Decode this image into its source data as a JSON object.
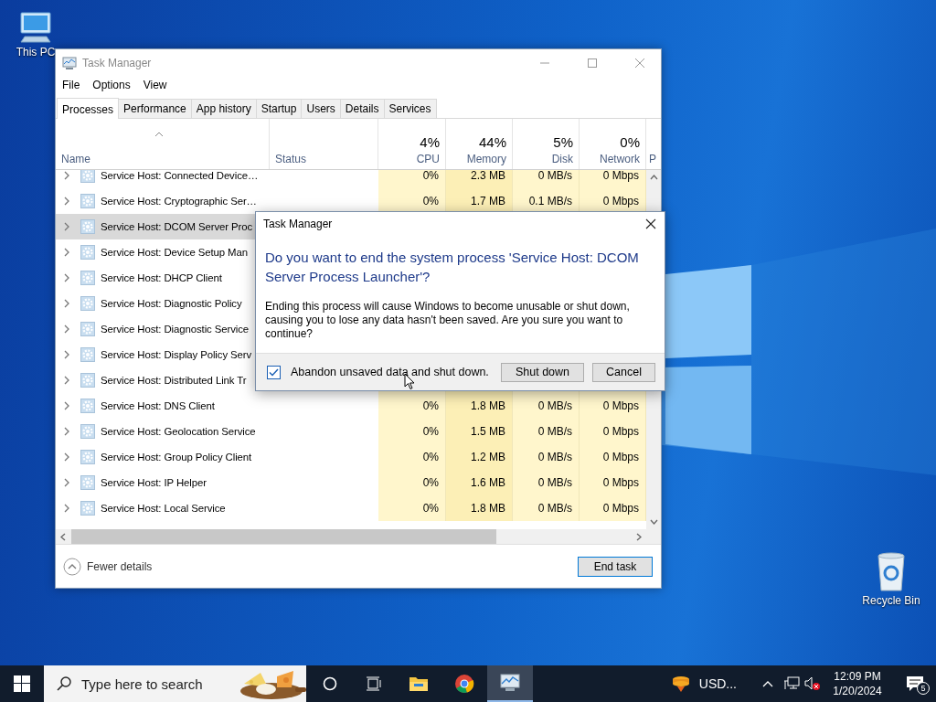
{
  "desktop_icons": [
    {
      "kind": "computer",
      "label": "This PC"
    },
    {
      "kind": "recycle-bin",
      "label": "Recycle Bin"
    }
  ],
  "window": {
    "title": "Task Manager",
    "menu": [
      "File",
      "Options",
      "View"
    ],
    "tabs": [
      {
        "label": "Processes",
        "selected": true
      },
      {
        "label": "Performance",
        "selected": false
      },
      {
        "label": "App history",
        "selected": false
      },
      {
        "label": "Startup",
        "selected": false
      },
      {
        "label": "Users",
        "selected": false
      },
      {
        "label": "Details",
        "selected": false
      },
      {
        "label": "Services",
        "selected": false
      }
    ],
    "columns": [
      {
        "label": "Name",
        "sorted": true
      },
      {
        "label": "Status",
        "sorted": false
      },
      {
        "label": "CPU",
        "total": "4%",
        "sorted": false
      },
      {
        "label": "Memory",
        "total": "44%",
        "sorted": false
      },
      {
        "label": "Disk",
        "total": "5%",
        "sorted": false
      },
      {
        "label": "Network",
        "total": "0%",
        "sorted": false
      },
      {
        "label": "P",
        "sorted": false
      }
    ],
    "rows": [
      {
        "name": "Service Host: Connected Device…",
        "expanded": false,
        "selected": false,
        "cpu": "0%",
        "memory": "2.3 MB",
        "disk": "0 MB/s",
        "network": "0 Mbps"
      },
      {
        "name": "Service Host: Cryptographic Ser…",
        "expanded": false,
        "selected": false,
        "cpu": "0%",
        "memory": "1.7 MB",
        "disk": "0.1 MB/s",
        "network": "0 Mbps"
      },
      {
        "name": "Service Host: DCOM Server Proc",
        "expanded": false,
        "selected": true
      },
      {
        "name": "Service Host: Device Setup Man",
        "expanded": false,
        "selected": false
      },
      {
        "name": "Service Host: DHCP Client",
        "expanded": false,
        "selected": false
      },
      {
        "name": "Service Host: Diagnostic Policy",
        "expanded": false,
        "selected": false
      },
      {
        "name": "Service Host: Diagnostic Service",
        "expanded": false,
        "selected": false
      },
      {
        "name": "Service Host: Display Policy Serv",
        "expanded": false,
        "selected": false
      },
      {
        "name": "Service Host: Distributed Link Tr",
        "expanded": false,
        "selected": false
      },
      {
        "name": "Service Host: DNS Client",
        "expanded": false,
        "selected": false,
        "cpu": "0%",
        "memory": "1.8 MB",
        "disk": "0 MB/s",
        "network": "0 Mbps"
      },
      {
        "name": "Service Host: Geolocation Service",
        "expanded": false,
        "selected": false,
        "cpu": "0%",
        "memory": "1.5 MB",
        "disk": "0 MB/s",
        "network": "0 Mbps"
      },
      {
        "name": "Service Host: Group Policy Client",
        "expanded": false,
        "selected": false,
        "cpu": "0%",
        "memory": "1.2 MB",
        "disk": "0 MB/s",
        "network": "0 Mbps"
      },
      {
        "name": "Service Host: IP Helper",
        "expanded": false,
        "selected": false,
        "cpu": "0%",
        "memory": "1.6 MB",
        "disk": "0 MB/s",
        "network": "0 Mbps"
      },
      {
        "name": "Service Host: Local Service",
        "expanded": false,
        "selected": false,
        "cpu": "0%",
        "memory": "1.8 MB",
        "disk": "0 MB/s",
        "network": "0 Mbps"
      }
    ],
    "details_toggle": "Fewer details",
    "end_button": "End task"
  },
  "dialog": {
    "title": "Task Manager",
    "heading": "Do you want to end the system process 'Service Host: DCOM Server Process Launcher'?",
    "message": "Ending this process will cause Windows to become unusable or shut down, causing you to lose any data hasn't been saved. Are you sure you want to continue?",
    "checkbox": {
      "label": "Abandon unsaved data and shut down.",
      "checked": true
    },
    "buttons": [
      "Shut down",
      "Cancel"
    ]
  },
  "taskbar": {
    "search": {
      "placeholder": "Type here to search"
    },
    "apps": [
      {
        "kind": "explorer",
        "active": false
      },
      {
        "kind": "browser",
        "active": false
      },
      {
        "kind": "task-manager",
        "active": true
      }
    ],
    "currency": "USD...",
    "time": "12:09 PM",
    "date": "1/20/2024",
    "notifications": "5"
  }
}
